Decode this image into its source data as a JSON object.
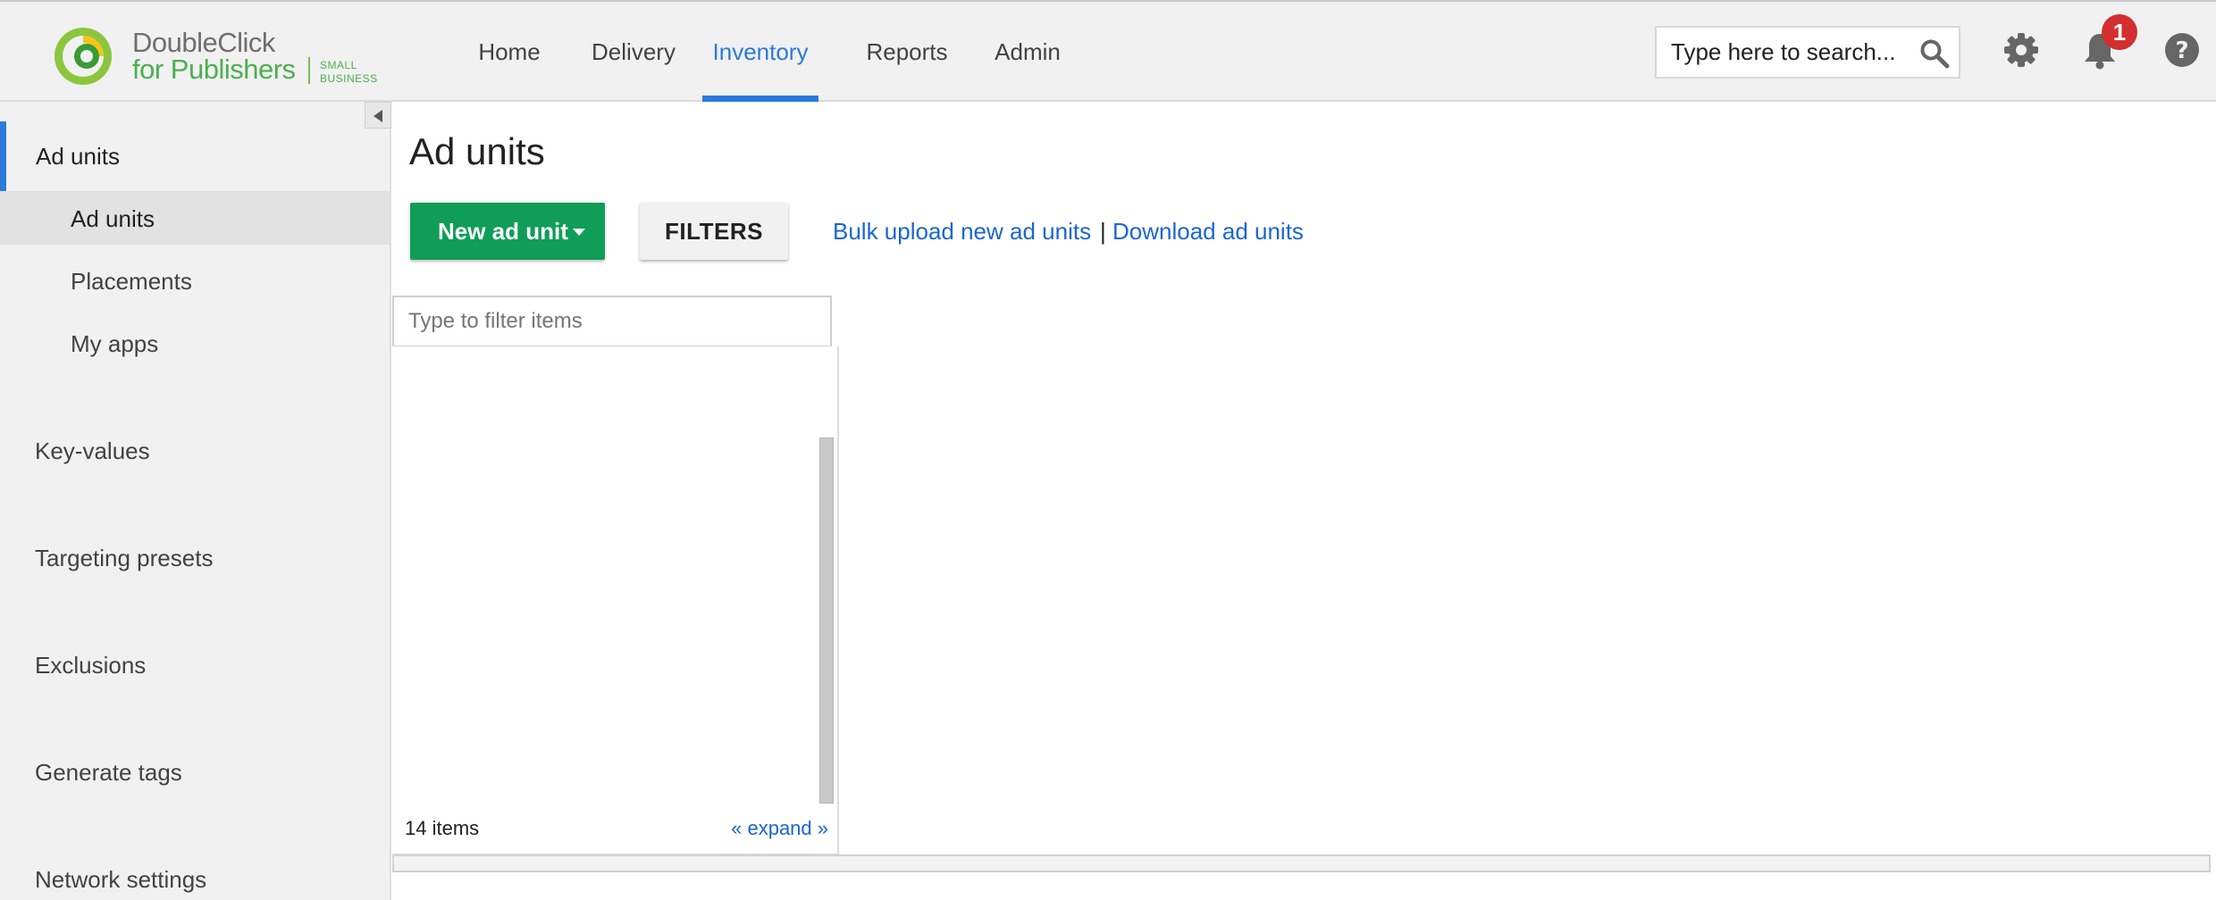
{
  "logo": {
    "line1": "DoubleClick",
    "line2": "for Publishers",
    "small1": "SMALL",
    "small2": "BUSINESS"
  },
  "nav": {
    "items": [
      "Home",
      "Delivery",
      "Inventory",
      "Reports",
      "Admin"
    ],
    "active": "Inventory"
  },
  "search": {
    "placeholder": "Type here to search..."
  },
  "notifications": {
    "count": "1"
  },
  "sidebar": {
    "section_title": "Ad units",
    "sub_items": [
      "Ad units",
      "Placements",
      "My apps"
    ],
    "active_sub_item": "Ad units",
    "items": [
      "Key-values",
      "Targeting presets",
      "Exclusions",
      "Generate tags",
      "Network settings"
    ]
  },
  "main": {
    "title": "Ad units",
    "new_button": "New ad unit",
    "filters_button": "FILTERS",
    "bulk_upload_link": "Bulk upload new ad units",
    "separator": "|",
    "download_link": "Download ad units",
    "filter_placeholder": "Type to filter items",
    "item_count": "14 items",
    "expand_link": "« expand »"
  },
  "colors": {
    "accent": "#2b7bdb",
    "primary_button": "#0f9d58",
    "badge": "#d32f2f",
    "header_bg": "#f1f1f1"
  },
  "icons": [
    "search-icon",
    "gear-icon",
    "bell-icon",
    "help-icon",
    "collapse-icon"
  ]
}
